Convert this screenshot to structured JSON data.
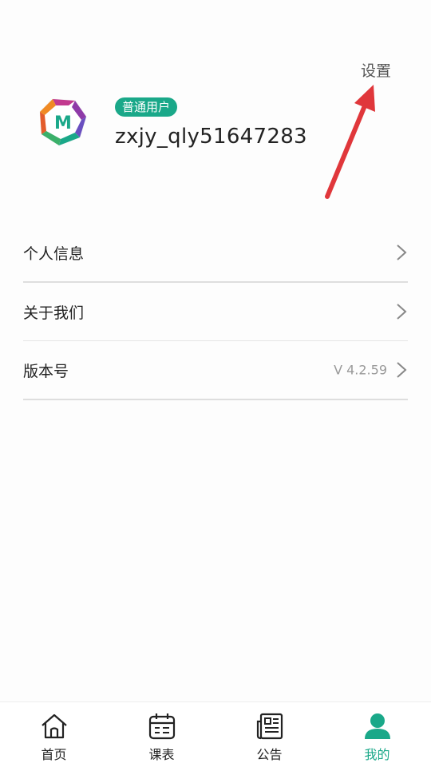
{
  "header": {
    "settings_label": "设置"
  },
  "profile": {
    "badge": "普通用户",
    "username": "zxjy_qly51647283",
    "avatar_icon": "app-logo-m"
  },
  "menu": [
    {
      "label": "个人信息",
      "value": ""
    },
    {
      "label": "关于我们",
      "value": ""
    },
    {
      "label": "版本号",
      "value": "V 4.2.59"
    }
  ],
  "tabs": [
    {
      "label": "首页",
      "icon": "home-icon",
      "active": false
    },
    {
      "label": "课表",
      "icon": "calendar-icon",
      "active": false
    },
    {
      "label": "公告",
      "icon": "newspaper-icon",
      "active": false
    },
    {
      "label": "我的",
      "icon": "user-icon",
      "active": true
    }
  ],
  "colors": {
    "accent": "#1aa889",
    "annotation_arrow": "#e0373b",
    "text": "#222222",
    "muted": "#999999"
  }
}
